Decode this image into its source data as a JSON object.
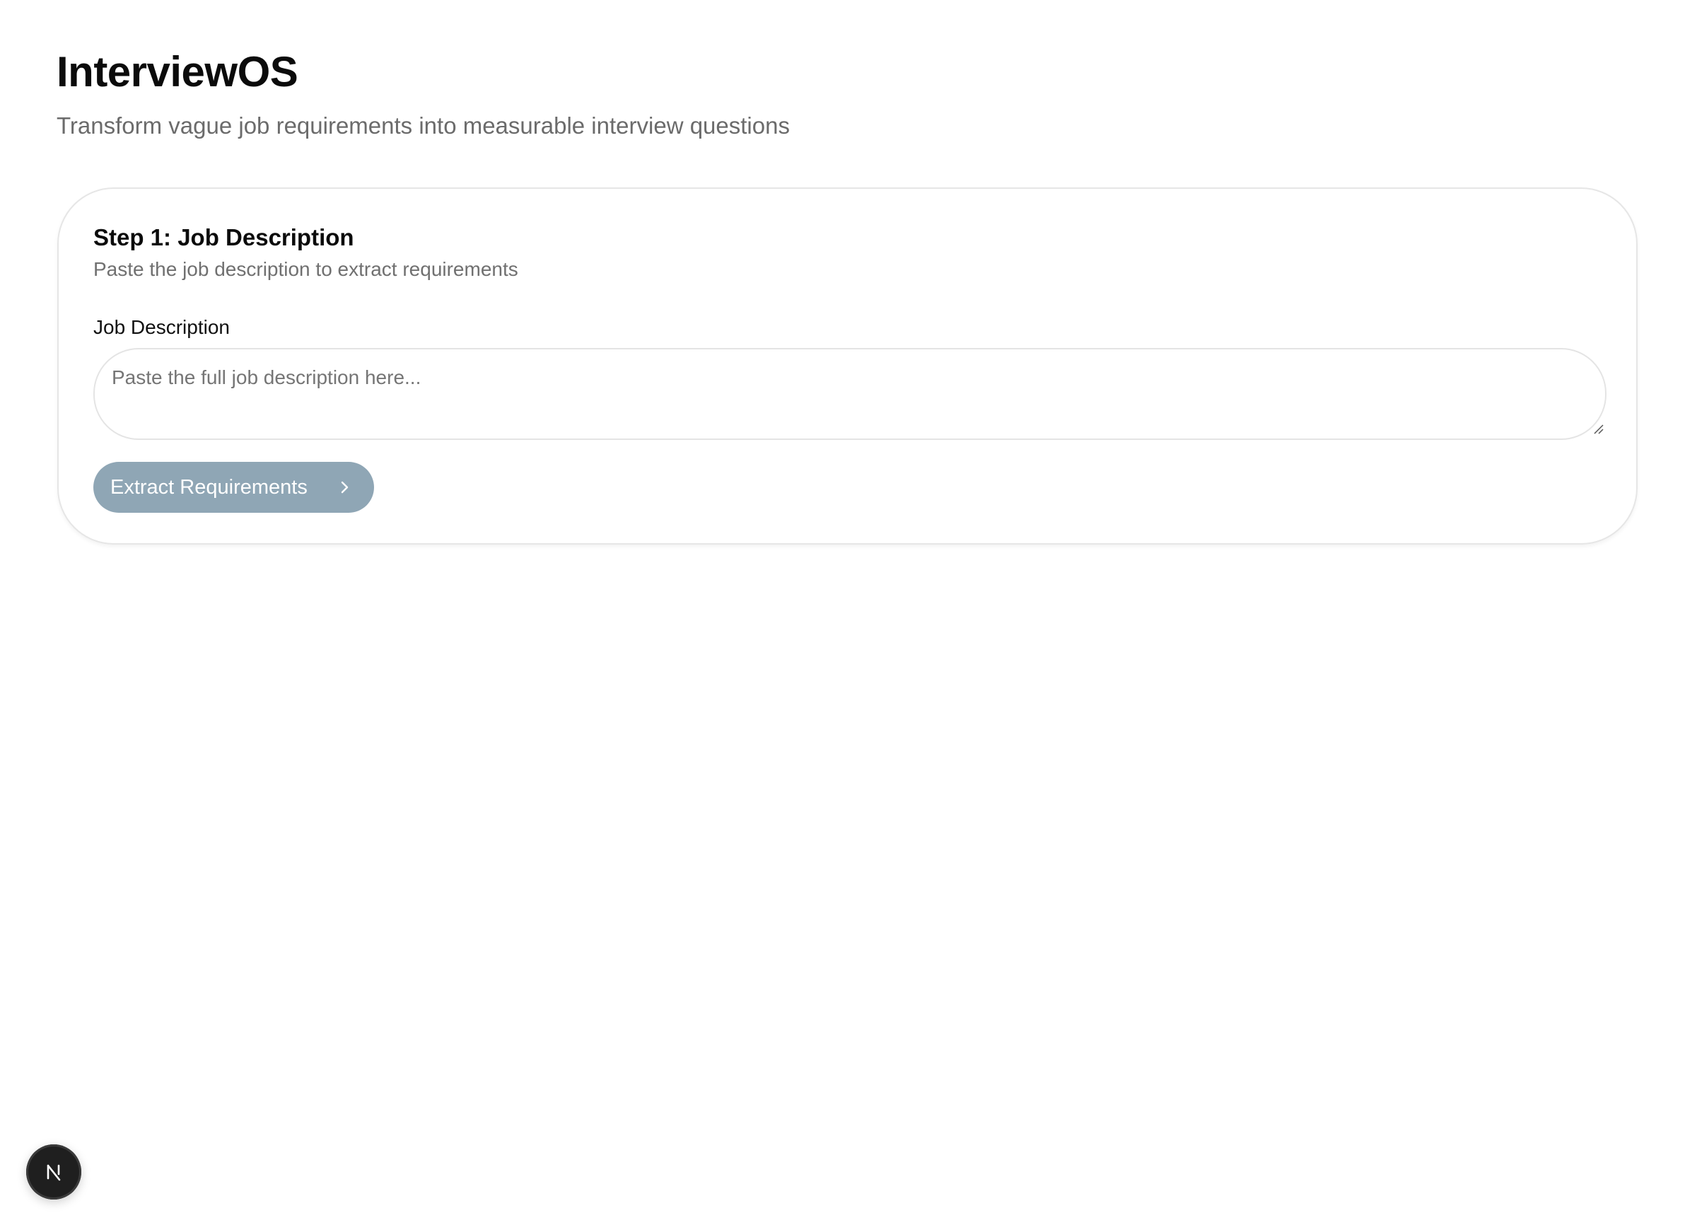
{
  "app": {
    "title": "InterviewOS",
    "subtitle": "Transform vague job requirements into measurable interview questions"
  },
  "step": {
    "title": "Step 1: Job Description",
    "description": "Paste the job description to extract requirements",
    "field_label": "Job Description",
    "textarea_value": "",
    "textarea_placeholder": "Paste the full job description here...",
    "button_label": "Extract Requirements",
    "button_icon": "chevron-right-icon"
  },
  "dev_badge": {
    "icon": "nextjs-logo-icon"
  },
  "colors": {
    "button_bg": "#8fa6b5",
    "card_border": "#e6e6e6",
    "subtitle_text": "#6b6b6b",
    "badge_bg": "#1f1f1f"
  }
}
